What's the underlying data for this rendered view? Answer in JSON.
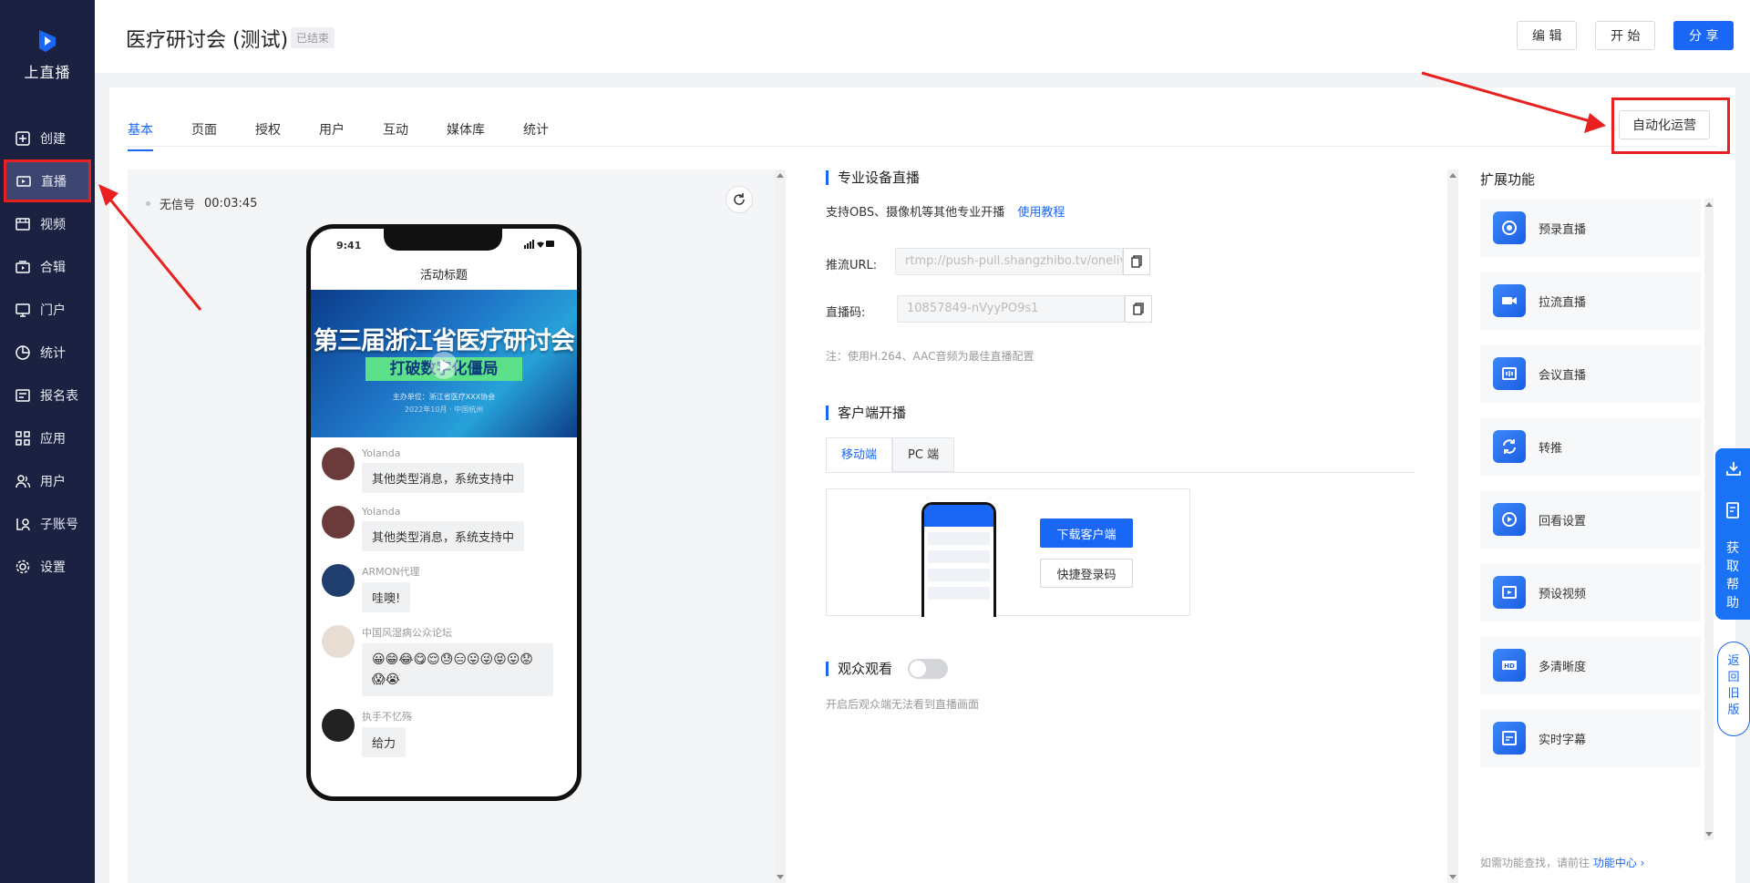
{
  "brand": {
    "name": "上直播"
  },
  "nav": [
    {
      "label": "创建",
      "icon": "plus-square-icon"
    },
    {
      "label": "直播",
      "icon": "video-camera-icon",
      "active": true
    },
    {
      "label": "视频",
      "icon": "film-icon"
    },
    {
      "label": "合辑",
      "icon": "collection-icon"
    },
    {
      "label": "门户",
      "icon": "monitor-icon"
    },
    {
      "label": "统计",
      "icon": "pie-chart-icon"
    },
    {
      "label": "报名表",
      "icon": "form-icon"
    },
    {
      "label": "应用",
      "icon": "apps-icon"
    },
    {
      "label": "用户",
      "icon": "users-icon"
    },
    {
      "label": "子账号",
      "icon": "sub-account-icon"
    },
    {
      "label": "设置",
      "icon": "gear-icon"
    }
  ],
  "header": {
    "title": "医疗研讨会 (测试)",
    "status": "已结束",
    "edit": "编 辑",
    "start": "开 始",
    "share": "分 享"
  },
  "tabs": [
    {
      "label": "基本",
      "active": true
    },
    {
      "label": "页面"
    },
    {
      "label": "授权"
    },
    {
      "label": "用户"
    },
    {
      "label": "互动"
    },
    {
      "label": "媒体库"
    },
    {
      "label": "统计"
    }
  ],
  "auto_ops": "自动化运营",
  "preview": {
    "signal": "无信号",
    "duration": "00:03:45",
    "phone": {
      "time": "9:41",
      "title": "活动标题",
      "hero_title": "第三届浙江省医疗研讨会",
      "hero_sub": "打破数字化僵局",
      "hero_line1": "主办单位：浙江省医疗XXX协会",
      "hero_line2": "2022年10月 · 中国杭州"
    },
    "chat": [
      {
        "name": "Yolanda",
        "text": "其他类型消息，系统支持中",
        "avatar_color": "#6b3b3b"
      },
      {
        "name": "Yolanda",
        "text": "其他类型消息，系统支持中",
        "avatar_color": "#6b3b3b"
      },
      {
        "name": "ARMON代理",
        "text": "哇噢!",
        "avatar_color": "#1f3e6e"
      },
      {
        "name": "中国风湿病公众论坛",
        "text": "😀😁😂😋😌😓😑😛😜😝😛😟😱😭",
        "avatar_color": "#e8ddd2"
      },
      {
        "name": "执手不忆殇",
        "text": "给力",
        "avatar_color": "#222222"
      }
    ]
  },
  "pro_stream": {
    "title": "专业设备直播",
    "desc": "支持OBS、摄像机等其他专业开播",
    "tutorial": "使用教程",
    "url_label": "推流URL:",
    "url_value": "rtmp://push-pull.shangzhibo.tv/onelive",
    "code_label": "直播码:",
    "code_value": "10857849-nVyyPO9s1",
    "note": "注：使用H.264、AAC音频为最佳直播配置"
  },
  "client_stream": {
    "title": "客户端开播",
    "tab_mobile": "移动端",
    "tab_pc": "PC 端",
    "download": "下载客户端",
    "quick_login": "快捷登录码"
  },
  "audience": {
    "title": "观众观看",
    "desc": "开启后观众端无法看到直播画面",
    "enabled": false
  },
  "extensions": {
    "title": "扩展功能",
    "items": [
      {
        "label": "预录直播",
        "icon": "record-icon"
      },
      {
        "label": "拉流直播",
        "icon": "camera-icon"
      },
      {
        "label": "会议直播",
        "icon": "meeting-icon"
      },
      {
        "label": "转推",
        "icon": "relay-icon"
      },
      {
        "label": "回看设置",
        "icon": "replay-icon"
      },
      {
        "label": "预设视频",
        "icon": "preset-video-icon"
      },
      {
        "label": "多清晰度",
        "icon": "hd-icon"
      },
      {
        "label": "实时字幕",
        "icon": "subtitle-icon"
      }
    ],
    "foot": "如需功能查找，请前往",
    "foot_link": "功能中心 ›"
  },
  "float": {
    "help": "获取帮助",
    "old": "返回旧版"
  },
  "colors": {
    "primary": "#1a66f5",
    "sidebar": "#1b2241",
    "annotation": "#e82020"
  }
}
